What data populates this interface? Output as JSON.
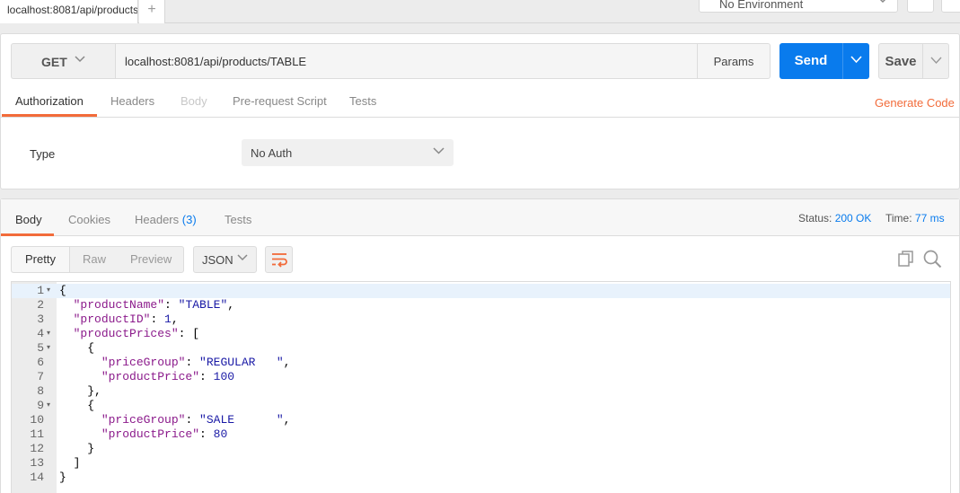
{
  "top": {
    "tab_title": "localhost:8081/api/products",
    "new_tab": "+",
    "environment": "No Environment"
  },
  "request": {
    "method": "GET",
    "url": "localhost:8081/api/products/TABLE",
    "params_label": "Params",
    "send_label": "Send",
    "save_label": "Save",
    "tabs": [
      {
        "label": "Authorization",
        "state": "active"
      },
      {
        "label": "Headers",
        "state": "normal"
      },
      {
        "label": "Body",
        "state": "disabled"
      },
      {
        "label": "Pre-request Script",
        "state": "normal"
      },
      {
        "label": "Tests",
        "state": "normal"
      }
    ],
    "generate_code": "Generate Code",
    "auth": {
      "type_label": "Type",
      "type_value": "No Auth"
    }
  },
  "response": {
    "tabs": {
      "body": "Body",
      "cookies": "Cookies",
      "headers": "Headers",
      "headers_count": "(3)",
      "tests": "Tests"
    },
    "status_label": "Status:",
    "status_value": "200 OK",
    "time_label": "Time:",
    "time_value": "77 ms",
    "view_modes": [
      "Pretty",
      "Raw",
      "Preview"
    ],
    "format": "JSON",
    "code_lines": [
      {
        "n": "1",
        "fold": true,
        "text": "{"
      },
      {
        "n": "2",
        "fold": false,
        "text": "  \"productName\": \"TABLE\","
      },
      {
        "n": "3",
        "fold": false,
        "text": "  \"productID\": 1,"
      },
      {
        "n": "4",
        "fold": true,
        "text": "  \"productPrices\": ["
      },
      {
        "n": "5",
        "fold": true,
        "text": "    {"
      },
      {
        "n": "6",
        "fold": false,
        "text": "      \"priceGroup\": \"REGULAR   \","
      },
      {
        "n": "7",
        "fold": false,
        "text": "      \"productPrice\": 100"
      },
      {
        "n": "8",
        "fold": false,
        "text": "    },"
      },
      {
        "n": "9",
        "fold": true,
        "text": "    {"
      },
      {
        "n": "10",
        "fold": false,
        "text": "      \"priceGroup\": \"SALE      \","
      },
      {
        "n": "11",
        "fold": false,
        "text": "      \"productPrice\": 80"
      },
      {
        "n": "12",
        "fold": false,
        "text": "    }"
      },
      {
        "n": "13",
        "fold": false,
        "text": "  ]"
      },
      {
        "n": "14",
        "fold": false,
        "text": "}"
      }
    ]
  },
  "colors": {
    "accent_orange": "#f26b3a",
    "send_blue": "#097bed"
  }
}
